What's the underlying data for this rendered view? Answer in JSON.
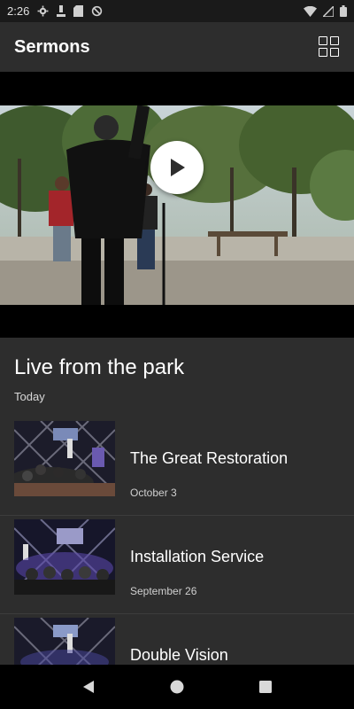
{
  "status_bar": {
    "time": "2:26"
  },
  "app_bar": {
    "title": "Sermons",
    "grid_icon": "grid-view-icon"
  },
  "video": {
    "play_icon": "play-icon"
  },
  "featured": {
    "title": "Live from the park",
    "date": "Today"
  },
  "sermons": [
    {
      "title": "The Great Restoration",
      "date": "October 3"
    },
    {
      "title": "Installation Service",
      "date": "September 26"
    },
    {
      "title": "Double Vision",
      "date": ""
    }
  ],
  "nav": {
    "back_icon": "back-icon",
    "home_icon": "home-icon",
    "recents_icon": "recents-icon"
  },
  "colors": {
    "background": "#2d2d2d",
    "status_bar": "#1a1a1a",
    "nav_bar": "#000000",
    "accent": "#ffffff"
  }
}
